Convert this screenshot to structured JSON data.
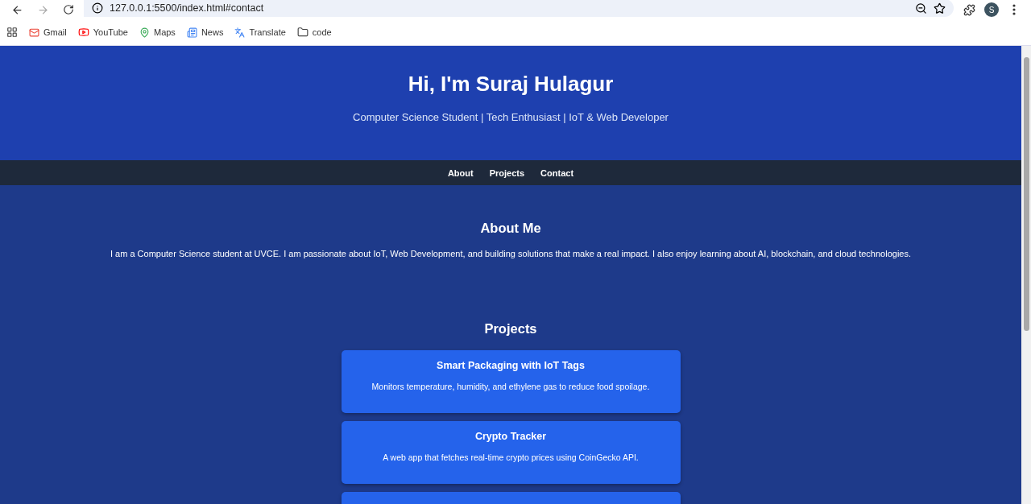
{
  "browser": {
    "url": "127.0.0.1:5500/index.html#contact",
    "profile_initial": "S",
    "bookmarks": [
      {
        "kind": "gmail",
        "label": "Gmail"
      },
      {
        "kind": "youtube",
        "label": "YouTube"
      },
      {
        "kind": "maps",
        "label": "Maps"
      },
      {
        "kind": "news",
        "label": "News"
      },
      {
        "kind": "translate",
        "label": "Translate"
      },
      {
        "kind": "folder",
        "label": "code"
      }
    ]
  },
  "header": {
    "title": "Hi, I'm Suraj Hulagur",
    "subtitle": "Computer Science Student | Tech Enthusiast | IoT & Web Developer"
  },
  "nav": [
    "About",
    "Projects",
    "Contact"
  ],
  "about": {
    "heading": "About Me",
    "text": "I am a Computer Science student at UVCE. I am passionate about IoT, Web Development, and building solutions that make a real impact. I also enjoy learning about AI, blockchain, and cloud technologies."
  },
  "projects": {
    "heading": "Projects",
    "cards": [
      {
        "kind": "project",
        "title": "Smart Packaging with IoT Tags",
        "description": "Monitors temperature, humidity, and ethylene gas to reduce food spoilage."
      },
      {
        "kind": "project",
        "title": "Crypto Tracker",
        "description": "A web app that fetches real-time crypto prices using CoinGecko API."
      },
      {
        "kind": "cut"
      }
    ]
  }
}
